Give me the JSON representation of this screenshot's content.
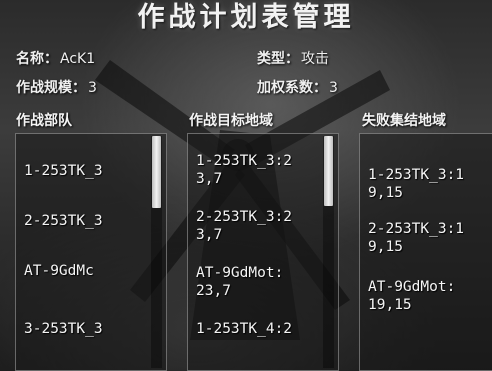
{
  "header": {
    "title": "作战计划表管理"
  },
  "info": {
    "name_label": "名称：",
    "name_value": "AcK1",
    "type_label": "类型：",
    "type_value": "攻击",
    "scale_label": "作战规模：",
    "scale_value": "3",
    "weight_label": "加权系数：",
    "weight_value": "3"
  },
  "columns": {
    "units": {
      "title": "作战部队",
      "items": [
        "1-253TK_3",
        "2-253TK_3",
        "AT-9GdMc",
        "3-253TK_3"
      ],
      "scroll_fraction": 0.0
    },
    "targets": {
      "title": "作战目标地域",
      "items": [
        "1-253TK_3:2\n3,7",
        "2-253TK_3:2\n3,7",
        "AT-9GdMot:\n23,7",
        "1-253TK_4:2"
      ],
      "scroll_fraction": 0.0
    },
    "fallback": {
      "title": "失败集结地域",
      "items": [
        "1-253TK_3:1\n9,15",
        "2-253TK_3:1\n9,15",
        "AT-9GdMot:\n19,15"
      ]
    }
  },
  "colors": {
    "panel_border": "#c8c8c8",
    "scroll_thumb": "#f2f2f2"
  }
}
